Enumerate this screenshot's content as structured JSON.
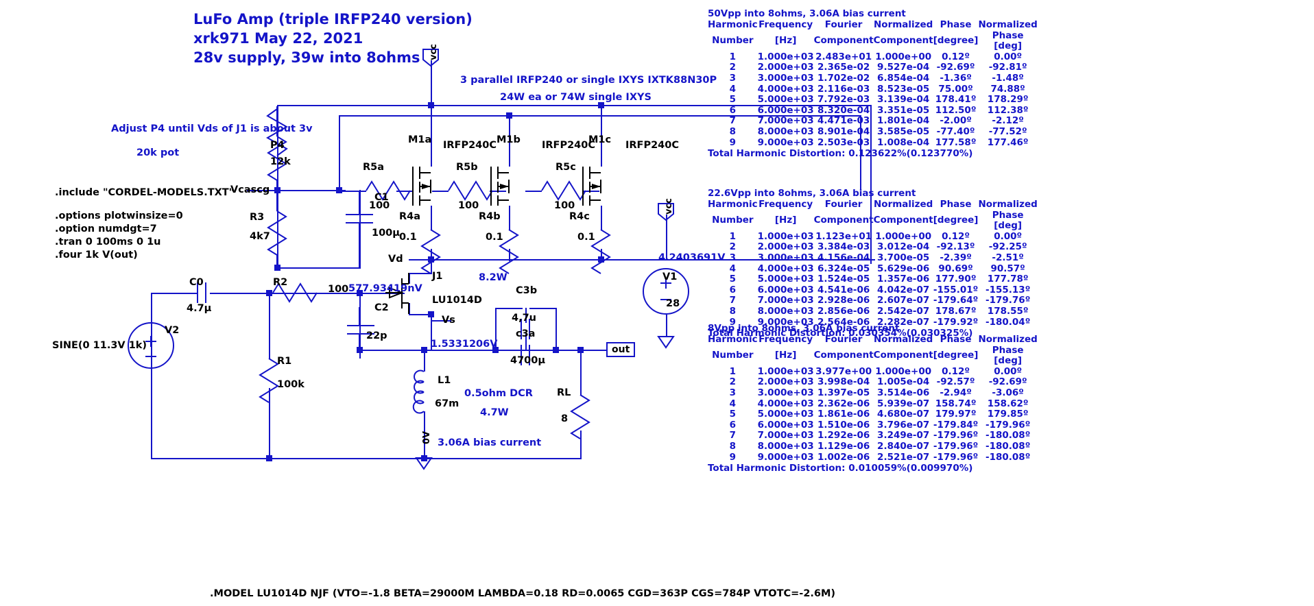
{
  "title": {
    "line1": "LuFo Amp (triple IRFP240 version)",
    "line2": "xrk971  May 22, 2021",
    "line3": "28v supply, 39w into 8ohms"
  },
  "notes": {
    "adjust": "Adjust P4 until Vds of J1 is about 3v",
    "pot": "20k pot",
    "parallel1": "3 parallel IRFP240 or single IXYS IXTK88N30P",
    "parallel2": "24W ea or 74W single IXYS",
    "bias": "3.06A bias current",
    "dcr": "0.5ohm DCR",
    "l1power": "4.7W",
    "j1power": "8.2W",
    "model": ".MODEL LU1014D NJF (VTO=-1.8 BETA=29000M LAMBDA=0.18 RD=0.0065 CGD=363P CGS=784P VTOTC=-2.6M)"
  },
  "spice": {
    "include": ".include \"CORDEL-MODELS.TXT\"",
    "l1": ".options plotwinsize=0",
    "l2": ".option numdgt=7",
    "l3": ".tran 0 100ms 0 1u",
    "l4": ".four 1k V(out)"
  },
  "components": {
    "p4": {
      "ref": "P4",
      "value": "12k"
    },
    "r3": {
      "ref": "R3",
      "value": "4k7"
    },
    "c1": {
      "ref": "C1",
      "value": "100µ"
    },
    "c0": {
      "ref": "C0",
      "value": "4.7µ"
    },
    "r2": {
      "ref": "R2",
      "value": "100"
    },
    "c2": {
      "ref": "C2",
      "value": "22p"
    },
    "r1": {
      "ref": "R1",
      "value": "100k"
    },
    "r5a": {
      "ref": "R5a",
      "value": "100"
    },
    "r5b": {
      "ref": "R5b",
      "value": "100"
    },
    "r5c": {
      "ref": "R5c",
      "value": "100"
    },
    "r4a": {
      "ref": "R4a",
      "value": "0.1"
    },
    "r4b": {
      "ref": "R4b",
      "value": "0.1"
    },
    "r4c": {
      "ref": "R4c",
      "value": "0.1"
    },
    "m1a": {
      "ref": "M1a",
      "value": "IRFP240C"
    },
    "m1b": {
      "ref": "M1b",
      "value": "IRFP240C"
    },
    "m1c": {
      "ref": "M1c",
      "value": "IRFP240C"
    },
    "j1": {
      "ref": "J1",
      "value": "LU1014D"
    },
    "c3b": {
      "ref": "C3b",
      "value": "4,7u"
    },
    "c3a": {
      "ref": "c3a",
      "value": "4700µ"
    },
    "l1": {
      "ref": "L1",
      "value": "67m"
    },
    "rl": {
      "ref": "RL",
      "value": "8"
    },
    "v1": {
      "ref": "V1",
      "value": "28"
    },
    "v2": {
      "ref": "V2",
      "value": "SINE(0 11.3V 1k)"
    }
  },
  "nets": {
    "vcascg": "Vcascg",
    "vd": "Vd",
    "vs": "Vs",
    "out": "out",
    "vcc1": "vcc",
    "vcc2": "vcc",
    "gnd": "0V"
  },
  "op_values": {
    "gate": "577.93419nV",
    "vd_rail": "4.2403691V",
    "vs_rail": "1.5331206V"
  },
  "fourier_tables": [
    {
      "caption": "50Vpp into 8ohms, 3.06A bias current",
      "headers": [
        [
          "Harmonic",
          "Frequency",
          "Fourier",
          "Normalized",
          "Phase",
          "Normalized"
        ],
        [
          "Number",
          "[Hz]",
          "Component",
          "Component",
          "[degree]",
          "Phase [deg]"
        ]
      ],
      "rows": [
        [
          "1",
          "1.000e+03",
          "2.483e+01",
          "1.000e+00",
          "0.12º",
          "0.00º"
        ],
        [
          "2",
          "2.000e+03",
          "2.365e-02",
          "9.527e-04",
          "-92.69º",
          "-92.81º"
        ],
        [
          "3",
          "3.000e+03",
          "1.702e-02",
          "6.854e-04",
          "-1.36º",
          "-1.48º"
        ],
        [
          "4",
          "4.000e+03",
          "2.116e-03",
          "8.523e-05",
          "75.00º",
          "74.88º"
        ],
        [
          "5",
          "5.000e+03",
          "7.792e-03",
          "3.139e-04",
          "178.41º",
          "178.29º"
        ],
        [
          "6",
          "6.000e+03",
          "8.320e-04",
          "3.351e-05",
          "112.50º",
          "112.38º"
        ],
        [
          "7",
          "7.000e+03",
          "4.471e-03",
          "1.801e-04",
          "-2.00º",
          "-2.12º"
        ],
        [
          "8",
          "8.000e+03",
          "8.901e-04",
          "3.585e-05",
          "-77.40º",
          "-77.52º"
        ],
        [
          "9",
          "9.000e+03",
          "2.503e-03",
          "1.008e-04",
          "177.58º",
          "177.46º"
        ]
      ],
      "thd": "Total Harmonic Distortion: 0.123622%(0.123770%)"
    },
    {
      "caption": "22.6Vpp into 8ohms, 3.06A bias current",
      "headers": [
        [
          "Harmonic",
          "Frequency",
          "Fourier",
          "Normalized",
          "Phase",
          "Normalized"
        ],
        [
          "Number",
          "[Hz]",
          "Component",
          "Component",
          "[degree]",
          "Phase [deg]"
        ]
      ],
      "rows": [
        [
          "1",
          "1.000e+03",
          "1.123e+01",
          "1.000e+00",
          "0.12º",
          "0.00º"
        ],
        [
          "2",
          "2.000e+03",
          "3.384e-03",
          "3.012e-04",
          "-92.13º",
          "-92.25º"
        ],
        [
          "3",
          "3.000e+03",
          "4.156e-04",
          "3.700e-05",
          "-2.39º",
          "-2.51º"
        ],
        [
          "4",
          "4.000e+03",
          "6.324e-05",
          "5.629e-06",
          "90.69º",
          "90.57º"
        ],
        [
          "5",
          "5.000e+03",
          "1.524e-05",
          "1.357e-06",
          "177.90º",
          "177.78º"
        ],
        [
          "6",
          "6.000e+03",
          "4.541e-06",
          "4.042e-07",
          "-155.01º",
          "-155.13º"
        ],
        [
          "7",
          "7.000e+03",
          "2.928e-06",
          "2.607e-07",
          "-179.64º",
          "-179.76º"
        ],
        [
          "8",
          "8.000e+03",
          "2.856e-06",
          "2.542e-07",
          "178.67º",
          "178.55º"
        ],
        [
          "9",
          "9.000e+03",
          "2.564e-06",
          "2.282e-07",
          "-179.92º",
          "-180.04º"
        ]
      ],
      "thd": "Total Harmonic Distortion: 0.030354%(0.030325%)"
    },
    {
      "caption": "8Vpp into 8ohms, 3.06A bias current",
      "headers": [
        [
          "Harmonic",
          "Frequency",
          "Fourier",
          "Normalized",
          "Phase",
          "Normalized"
        ],
        [
          "Number",
          "[Hz]",
          "Component",
          "Component",
          "[degree]",
          "Phase [deg]"
        ]
      ],
      "rows": [
        [
          "1",
          "1.000e+03",
          "3.977e+00",
          "1.000e+00",
          "0.12º",
          "0.00º"
        ],
        [
          "2",
          "2.000e+03",
          "3.998e-04",
          "1.005e-04",
          "-92.57º",
          "-92.69º"
        ],
        [
          "3",
          "3.000e+03",
          "1.397e-05",
          "3.514e-06",
          "-2.94º",
          "-3.06º"
        ],
        [
          "4",
          "4.000e+03",
          "2.362e-06",
          "5.939e-07",
          "158.74º",
          "158.62º"
        ],
        [
          "5",
          "5.000e+03",
          "1.861e-06",
          "4.680e-07",
          "179.97º",
          "179.85º"
        ],
        [
          "6",
          "6.000e+03",
          "1.510e-06",
          "3.796e-07",
          "-179.84º",
          "-179.96º"
        ],
        [
          "7",
          "7.000e+03",
          "1.292e-06",
          "3.249e-07",
          "-179.96º",
          "-180.08º"
        ],
        [
          "8",
          "8.000e+03",
          "1.129e-06",
          "2.840e-07",
          "-179.96º",
          "-180.08º"
        ],
        [
          "9",
          "9.000e+03",
          "1.002e-06",
          "2.521e-07",
          "-179.96º",
          "-180.08º"
        ]
      ],
      "thd": "Total Harmonic Distortion: 0.010059%(0.009970%)"
    }
  ],
  "colors": {
    "wire": "#1414c8",
    "text": "#000000",
    "annotation": "#1414c8"
  }
}
